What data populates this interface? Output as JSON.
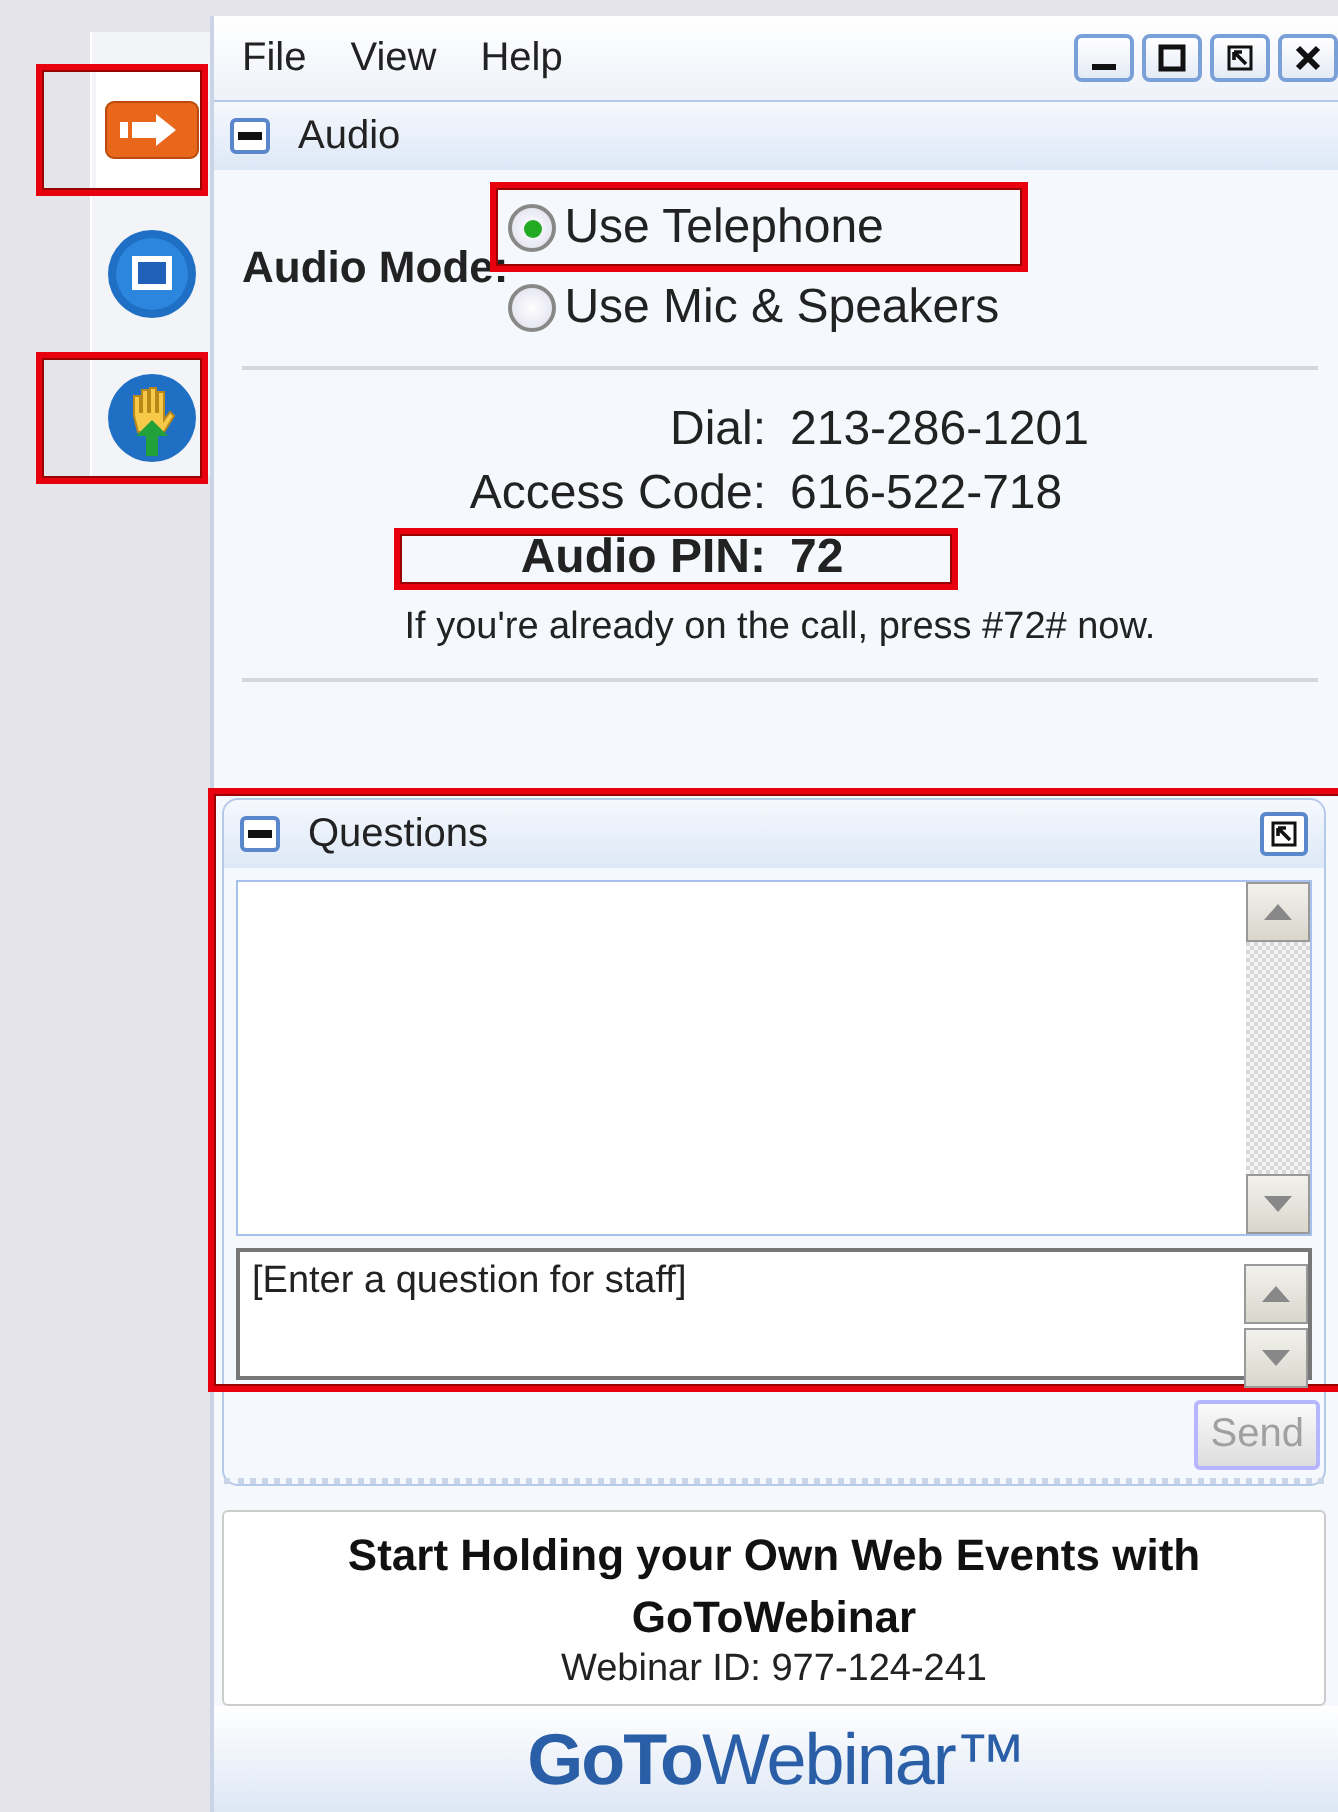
{
  "menu": [
    "File",
    "View",
    "Help"
  ],
  "window_buttons": [
    {
      "kind": "minimize"
    },
    {
      "kind": "maximize"
    },
    {
      "kind": "restore"
    },
    {
      "kind": "close"
    }
  ],
  "toolbar": [
    {
      "kind": "arrow",
      "highlighted": true
    },
    {
      "kind": "screen",
      "highlighted": false
    },
    {
      "kind": "hand",
      "highlighted": true
    }
  ],
  "audio": {
    "title": "Audio",
    "expanded": true,
    "mode_label": "Audio Mode:",
    "options": [
      {
        "label": "Use Telephone",
        "selected": true,
        "highlighted": true
      },
      {
        "label": "Use Mic & Speakers",
        "selected": false,
        "highlighted": false
      }
    ],
    "details": [
      {
        "label": "Dial:",
        "value": "213-286-1201",
        "emphasis": false,
        "highlighted": false
      },
      {
        "label": "Access Code:",
        "value": "616-522-718",
        "emphasis": false,
        "highlighted": false
      },
      {
        "label": "Audio PIN:",
        "value": "72",
        "emphasis": true,
        "highlighted": true
      }
    ],
    "note": "If you're already on the call, press #72# now."
  },
  "questions": {
    "title": "Questions",
    "expanded": true,
    "highlighted": true,
    "placeholder": "[Enter a question for staff]",
    "send": "Send",
    "send_disabled": true
  },
  "promo": {
    "headline": "Start Holding your Own Web Events with GoToWebinar",
    "webinar_id": "Webinar ID: 977-124-241"
  },
  "logo": "**GoTo**Webinar™"
}
